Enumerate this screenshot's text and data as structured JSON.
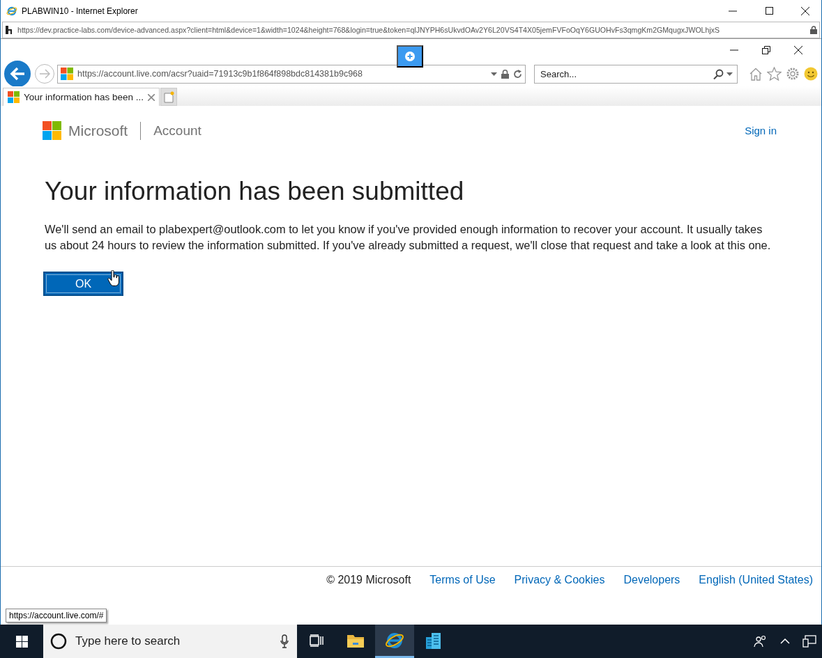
{
  "outer_window": {
    "title": "PLABWIN10 - Internet Explorer",
    "address": "https://dev.practice-labs.com/device-advanced.aspx?client=html&device=1&width=1024&height=768&login=true&token=qlJNYPH6sUkvdOAv2Y6L20VS4T4X05jemFVFoOqY6GUOHvFs3qmgKm2GMqugxJWOLhjxS"
  },
  "browser": {
    "address": "https://account.live.com/acsr?uaid=71913c9b1f864f898bdc814381b9c968",
    "search_placeholder": "Search...",
    "tabs": [
      {
        "label": "Your information has been ...",
        "selected": true
      }
    ]
  },
  "page": {
    "brand": "Microsoft",
    "product": "Account",
    "sign_in": "Sign in",
    "heading": "Your information has been submitted",
    "body": "We'll send an email to plabexpert@outlook.com to let you know if you've provided enough information to recover your account. It usually takes us about 24 hours to review the information submitted. If you've already submitted a request, we'll close that request and take a look at this one.",
    "ok_button": "OK"
  },
  "footer": {
    "copyright": "© 2019 Microsoft",
    "links": [
      "Terms of Use",
      "Privacy & Cookies",
      "Developers",
      "English (United States)"
    ]
  },
  "status_url": "https://account.live.com/#",
  "taskbar": {
    "search_placeholder": "Type here to search",
    "apps": [
      {
        "kind": "task-view",
        "selected": false
      },
      {
        "kind": "folder",
        "selected": false
      },
      {
        "kind": "ie",
        "selected": true
      },
      {
        "kind": "buildings",
        "selected": false
      }
    ]
  }
}
